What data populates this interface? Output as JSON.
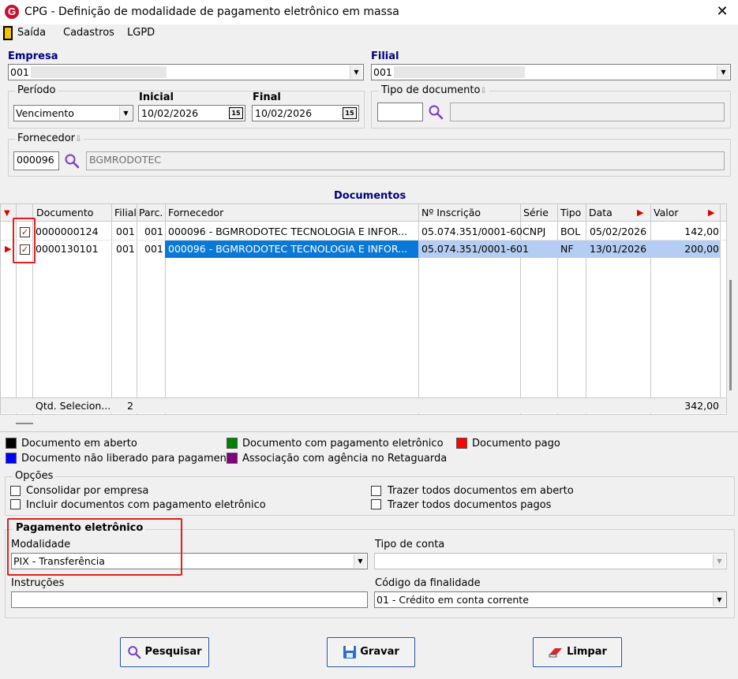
{
  "window": {
    "title": "CPG - Definição de modalidade de pagamento eletrônico em massa",
    "logo_letter": "G"
  },
  "menu": {
    "items": [
      "Saída",
      "Cadastros",
      "LGPD"
    ]
  },
  "empresa": {
    "label": "Empresa",
    "value": "001"
  },
  "filial": {
    "label": "Filial",
    "value": "001"
  },
  "periodo": {
    "label": "Período",
    "type_value": "Vencimento",
    "inicial_label": "Inicial",
    "inicial_value": "10/02/2026",
    "final_label": "Final",
    "final_value": "10/02/2026",
    "calendar_glyph": "15"
  },
  "tipo_documento": {
    "label": "Tipo de documento",
    "value": "",
    "description": ""
  },
  "fornecedor": {
    "label": "Fornecedor",
    "code": "000096",
    "name": "BGMRODOTEC"
  },
  "documentos": {
    "title": "Documentos",
    "columns": [
      "Documento",
      "Filial",
      "Parc.",
      "Fornecedor",
      "Nº Inscrição",
      "Série",
      "Tipo",
      "Data",
      "Valor"
    ],
    "rows": [
      {
        "checked": true,
        "documento": "0000000124",
        "filial": "001",
        "parc": "001",
        "fornecedor": "000096 - BGMRODOTEC TECNOLOGIA E INFOR...",
        "inscricao": "05.074.351/0001-60",
        "serie": "CNPJ",
        "tipo": "BOL",
        "data": "05/02/2026",
        "valor": "142,00"
      },
      {
        "checked": true,
        "documento": "0000130101",
        "filial": "001",
        "parc": "001",
        "fornecedor": "000096 - BGMRODOTEC TECNOLOGIA E INFOR...",
        "inscricao": "05.074.351/0001-60",
        "serie": "1",
        "tipo": "NF",
        "data": "13/01/2026",
        "valor": "200,00"
      }
    ],
    "footer": {
      "label": "Qtd. Selecion...",
      "count": "2",
      "total": "342,00"
    }
  },
  "legend": [
    {
      "color": "#000000",
      "label": "Documento em aberto"
    },
    {
      "color": "#008000",
      "label": "Documento com pagamento eletrônico"
    },
    {
      "color": "#ff0000",
      "label": "Documento pago"
    },
    {
      "color": "#0000ff",
      "label": "Documento não liberado para pagamento"
    },
    {
      "color": "#800080",
      "label": "Associação com agência no Retaguarda"
    }
  ],
  "opcoes": {
    "label": "Opções",
    "items": [
      "Consolidar por empresa",
      "Incluir documentos com pagamento eletrônico",
      "Trazer todos documentos em aberto",
      "Trazer todos documentos pagos"
    ]
  },
  "pagamento": {
    "label": "Pagamento eletrônico",
    "modalidade_label": "Modalidade",
    "modalidade_value": "PIX - Transferência",
    "tipo_conta_label": "Tipo de conta",
    "tipo_conta_value": "",
    "instrucoes_label": "Instruções",
    "instrucoes_value": "",
    "finalidade_label": "Código da finalidade",
    "finalidade_value": "01 - Crédito em conta corrente"
  },
  "buttons": {
    "pesquisar": "Pesquisar",
    "gravar": "Gravar",
    "limpar": "Limpar"
  },
  "colors": {
    "accent": "#00007f",
    "selection": "#0a78d7",
    "highlight": "#e02020"
  }
}
